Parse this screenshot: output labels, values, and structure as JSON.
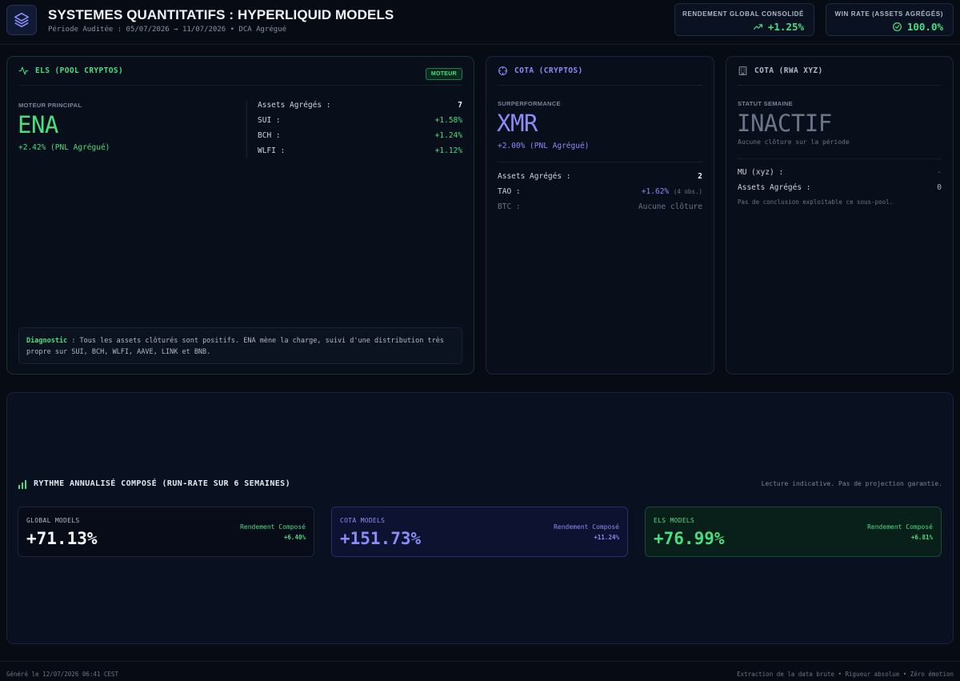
{
  "header": {
    "title": "SYSTEMES QUANTITATIFS : HYPERLIQUID MODELS",
    "subtitle": "Période Auditée : 05/07/2026 → 11/07/2026 • DCA Agrégué",
    "kpis": [
      {
        "label": "RENDEMENT GLOBAL CONSOLIDÉ",
        "value": "+1.25%",
        "icon": "trending-up-icon"
      },
      {
        "label": "WIN RATE (ASSETS AGRÉGÉS)",
        "value": "100.0%",
        "icon": "check-circle-icon"
      }
    ]
  },
  "els": {
    "title": "ELS (POOL CRYPTOS)",
    "badge": "MOTEUR",
    "engine_label": "MOTEUR PRINCIPAL",
    "engine_value": "ENA",
    "engine_pnl": "+2.42% (PNL Agrégué)",
    "assets_label": "Assets Agrégés :",
    "assets_count": "7",
    "assets": [
      {
        "name": "SUI :",
        "value": "+1.58%"
      },
      {
        "name": "BCH :",
        "value": "+1.24%"
      },
      {
        "name": "WLFI :",
        "value": "+1.12%"
      }
    ],
    "diag_label": "Diagnostic",
    "diag_text": " : Tous les assets clôturés sont positifs. ENA mène la charge, suivi d'une distribution très propre sur SUI, BCH, WLFI, AAVE, LINK et BNB."
  },
  "cota_crypto": {
    "title": "COTA (CRYPTOS)",
    "label": "SURPERFORMANCE",
    "value": "XMR",
    "pnl": "+2.00% (PNL Agrégué)",
    "assets_label": "Assets Agrégés :",
    "assets_count": "2",
    "tao_name": "TAO :",
    "tao_value": "+1.62%",
    "tao_obs": "(4 obs.)",
    "btc_name": "BTC :",
    "btc_value": "Aucune clôture"
  },
  "cota_rwa": {
    "title": "COTA (RWA XYZ)",
    "label": "STATUT SEMAINE",
    "value": "INACTIF",
    "sub": "Aucune clôture sur la période",
    "mu_name": "MU (xyz) :",
    "mu_value": "-",
    "assets_label": "Assets Agrégés :",
    "assets_count": "0",
    "note": "Pas de conclusion exploitable ce sous-pool."
  },
  "rythme": {
    "title": "RYTHME ANNUALISÉ COMPOSÉ (RUN-RATE SUR 6 SEMAINES)",
    "note": "Lecture indicative. Pas de projection garantie.",
    "boxes": [
      {
        "label": "GLOBAL MODELS",
        "value": "+71.13%",
        "rlabel": "Rendement Composé",
        "rvalue": "+6.40%"
      },
      {
        "label": "COTA MODELS",
        "value": "+151.73%",
        "rlabel": "Rendement Composé",
        "rvalue": "+11.24%"
      },
      {
        "label": "ELS MODELS",
        "value": "+76.99%",
        "rlabel": "Rendement Composé",
        "rvalue": "+6.81%"
      }
    ]
  },
  "footer": {
    "left": "Généré le 12/07/2026 06:41 CEST",
    "right": "Extraction de la data brute • Rigueur absolue • Zéro émotion"
  },
  "colors": {
    "green": "#4ade80",
    "purple": "#8b8cf6",
    "background": "#060b14"
  }
}
